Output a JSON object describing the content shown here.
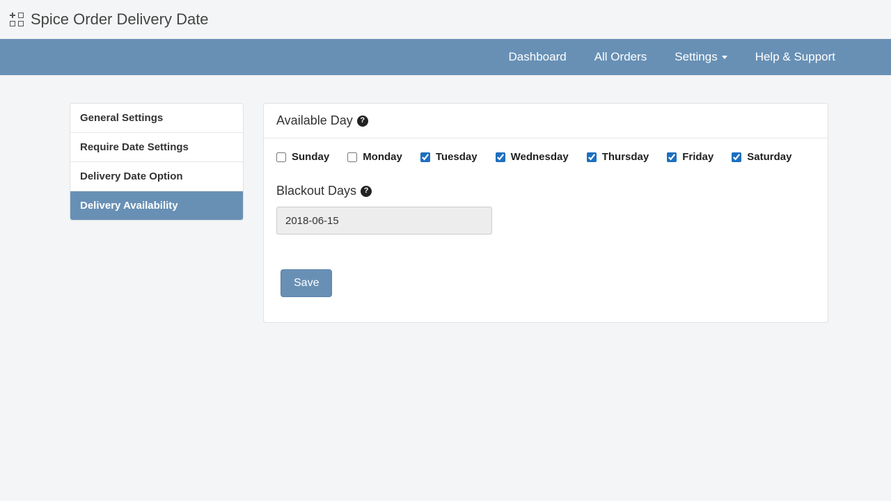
{
  "app": {
    "title": "Spice Order Delivery Date"
  },
  "nav": {
    "dashboard": "Dashboard",
    "all_orders": "All Orders",
    "settings": "Settings",
    "help": "Help & Support"
  },
  "sidebar": {
    "items": [
      {
        "label": "General Settings"
      },
      {
        "label": "Require Date Settings"
      },
      {
        "label": "Delivery Date Option"
      },
      {
        "label": "Delivery Availability"
      }
    ],
    "active_index": 3
  },
  "panel": {
    "available_day_title": "Available Day",
    "days": [
      {
        "label": "Sunday",
        "checked": false
      },
      {
        "label": "Monday",
        "checked": false
      },
      {
        "label": "Tuesday",
        "checked": true
      },
      {
        "label": "Wednesday",
        "checked": true
      },
      {
        "label": "Thursday",
        "checked": true
      },
      {
        "label": "Friday",
        "checked": true
      },
      {
        "label": "Saturday",
        "checked": true
      }
    ],
    "blackout_title": "Blackout Days",
    "blackout_value": "2018-06-15",
    "save_label": "Save"
  },
  "colors": {
    "accent": "#6890b5",
    "page_bg": "#f3f5f6"
  }
}
